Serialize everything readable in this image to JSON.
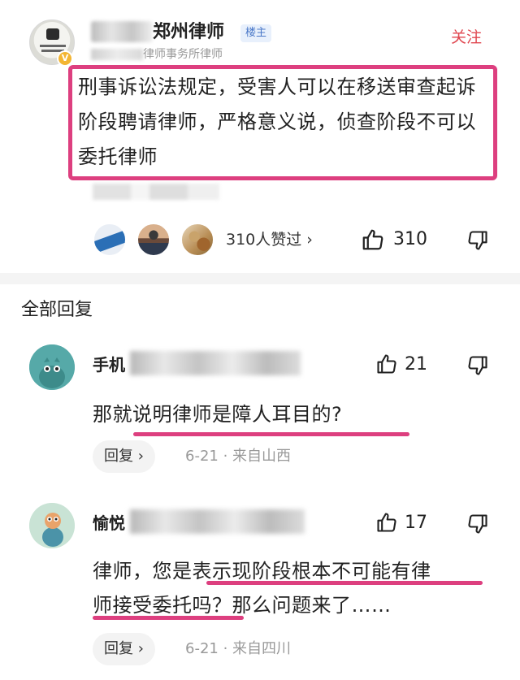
{
  "post": {
    "author_name": "郑州律师",
    "owner_tag": "楼主",
    "subtitle": "律师事务所律师",
    "follow_label": "关注",
    "body": "刑事诉讼法规定，受害人可以在移送审查起诉阶段聘请律师，严格意义说，侦查阶段不可以委托律师",
    "likes_text": "310人赞过 ›",
    "like_count": "310"
  },
  "replies": {
    "section_title": "全部回复",
    "items": [
      {
        "name": "手机",
        "like_count": "21",
        "text": "那就说明律师是障人耳目的?",
        "reply_label": "回复 ›",
        "meta": "6-21 · 来自山西"
      },
      {
        "name": "愉悦",
        "like_count": "17",
        "text_line1": "律师，您是表示现阶段根本不可能有律",
        "text_line2": "师接受委托吗？那么问题来了……",
        "reply_label": "回复 ›",
        "meta": "6-21 · 来自四川"
      }
    ]
  },
  "colors": {
    "highlight": "#dd3f7f",
    "follow": "#e0464f",
    "owner_tag_bg": "#e8f0fc",
    "owner_tag_text": "#4a78c8"
  }
}
